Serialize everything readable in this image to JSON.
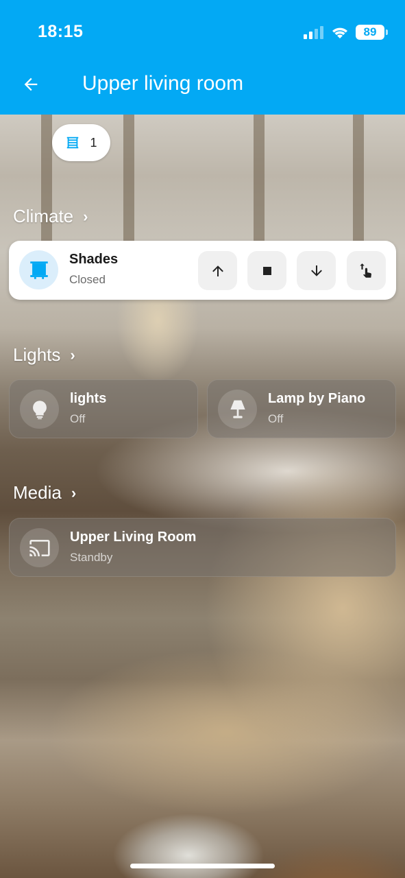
{
  "status_bar": {
    "time": "18:15",
    "battery": "89"
  },
  "header": {
    "title": "Upper living room"
  },
  "chip": {
    "count": "1",
    "icon": "window-shutter-icon"
  },
  "sections": {
    "climate": {
      "title": "Climate"
    },
    "lights": {
      "title": "Lights"
    },
    "media": {
      "title": "Media"
    }
  },
  "shades": {
    "name": "Shades",
    "state": "Closed",
    "icon": "window-shutter-icon"
  },
  "lights": [
    {
      "name": "lights",
      "state": "Off",
      "icon": "ceiling-light-icon"
    },
    {
      "name": "Lamp by Piano",
      "state": "Off",
      "icon": "lamp-icon"
    }
  ],
  "media": {
    "name": "Upper Living Room",
    "state": "Standby",
    "icon": "cast-icon"
  },
  "colors": {
    "accent": "#03a9f4",
    "card_light": "#ffffff",
    "glass": "#78736e"
  }
}
